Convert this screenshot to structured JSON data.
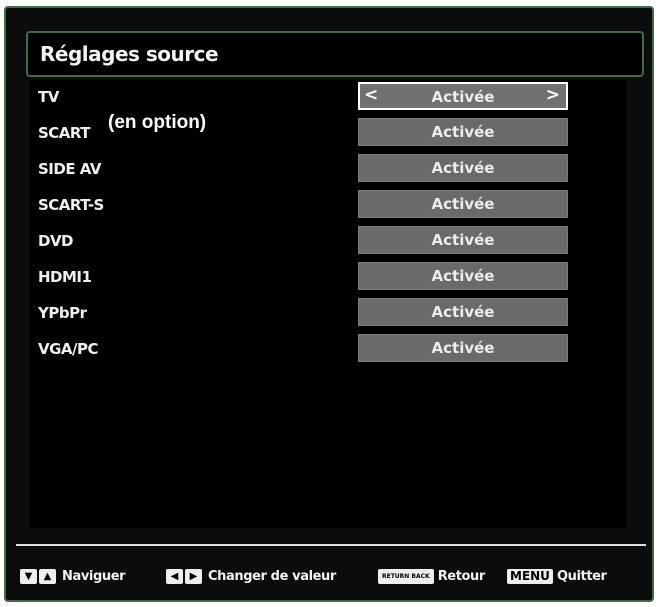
{
  "menu": {
    "title": "Réglages source"
  },
  "rows": [
    {
      "label": "TV",
      "value": "Activée",
      "selected": true
    },
    {
      "label": "SCART",
      "value": "Activée"
    },
    {
      "label": "SIDE AV",
      "value": "Activée"
    },
    {
      "label": "SCART-S",
      "value": "Activée"
    },
    {
      "label": "DVD",
      "value": "Activée"
    },
    {
      "label": "HDMI1",
      "value": "Activée"
    },
    {
      "label": "YPbPr",
      "value": "Activée"
    },
    {
      "label": "VGA/PC",
      "value": "Activée"
    }
  ],
  "optional_note": "(en option)",
  "arrows": {
    "left": "<",
    "right": ">"
  },
  "footer": {
    "navigate": {
      "keys": [
        "▼",
        "▲"
      ],
      "label": "Naviguer"
    },
    "change": {
      "keys": [
        "◀",
        "▶"
      ],
      "label": "Changer de valeur"
    },
    "back": {
      "key": "RETURN BACK",
      "label": "Retour"
    },
    "quit": {
      "key": "MENU",
      "label": "Quitter"
    }
  },
  "colors": {
    "frame_border": "#3f6b45",
    "background": "#0c0c0c",
    "value_box": "#6a6a6a",
    "text": "#f0f0f0"
  }
}
